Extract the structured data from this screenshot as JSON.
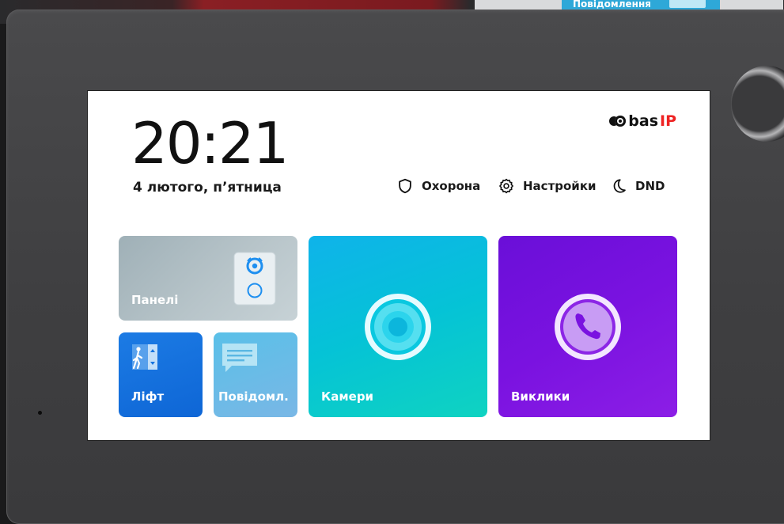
{
  "background": {
    "banner_text": "Повідомлення"
  },
  "status": {
    "time": "20:21",
    "date": "4 лютого, п’ятница"
  },
  "brand": {
    "name": "bas",
    "suffix": "IP"
  },
  "quick_actions": [
    {
      "label": "Охорона",
      "icon": "shield-icon"
    },
    {
      "label": "Настройки",
      "icon": "gear-icon"
    },
    {
      "label": "DND",
      "icon": "moon-icon"
    }
  ],
  "tiles": {
    "panels": {
      "label": "Панелі",
      "icon": "door-panel-icon",
      "color": "#a9b8be"
    },
    "lift": {
      "label": "Ліфт",
      "icon": "elevator-icon",
      "color": "#1473e0"
    },
    "messages": {
      "label": "Повідомл.",
      "icon": "chat-icon",
      "color": "#62bde8"
    },
    "cameras": {
      "label": "Камери",
      "icon": "camera-lens-icon",
      "color": "#05c3d6"
    },
    "calls": {
      "label": "Виклики",
      "icon": "phone-icon",
      "color": "#7a12e0"
    }
  }
}
